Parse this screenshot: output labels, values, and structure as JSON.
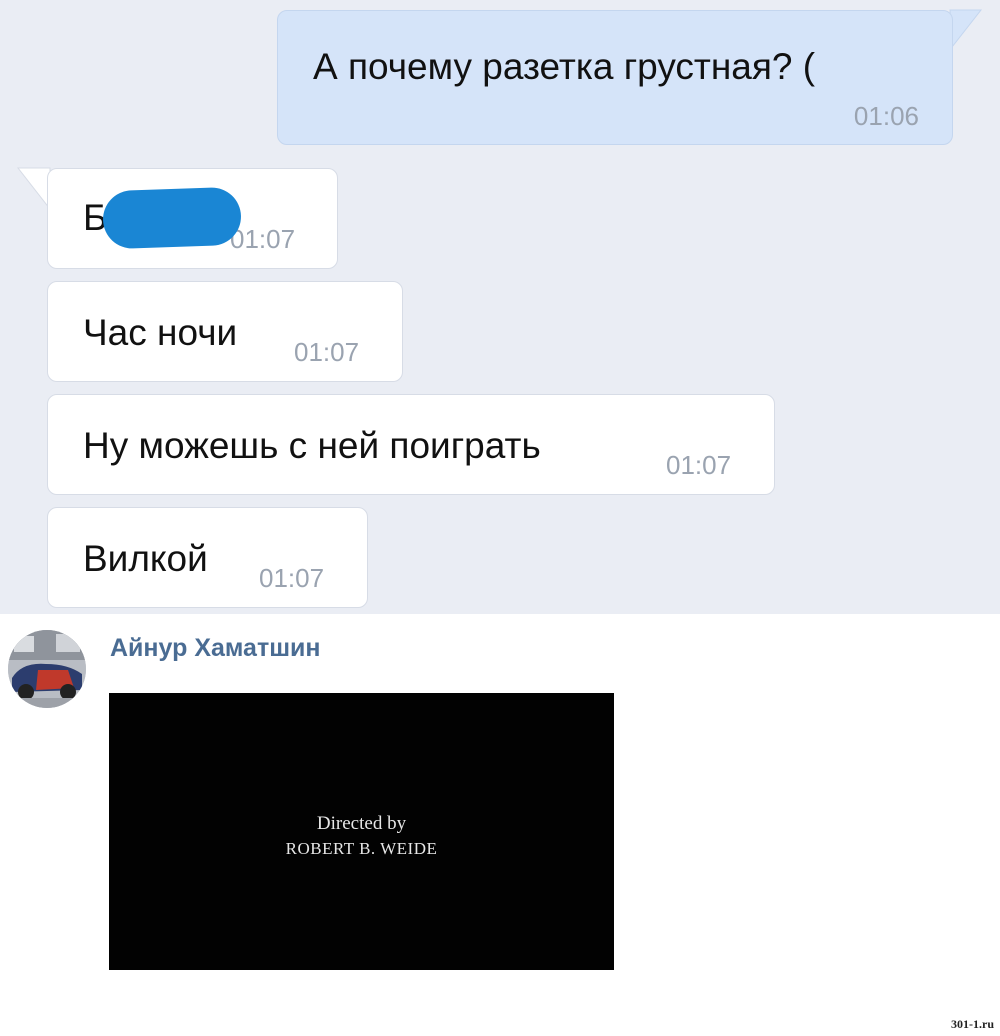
{
  "messages": [
    {
      "direction": "outgoing",
      "text": "А почему разетка грустная? (",
      "time": "01:06"
    },
    {
      "direction": "incoming",
      "text": "Б",
      "time": "01:07",
      "redacted": true
    },
    {
      "direction": "incoming",
      "text": "Час ночи",
      "time": "01:07"
    },
    {
      "direction": "incoming",
      "text": "Ну можешь с ней поиграть",
      "time": "01:07"
    },
    {
      "direction": "incoming",
      "text": "Вилкой",
      "time": "01:07"
    }
  ],
  "comment": {
    "author": "Айнур Хаматшин",
    "video": {
      "line1": "Directed by",
      "line2": "ROBERT B. WEIDE"
    }
  },
  "watermark": "301-1.ru",
  "colors": {
    "chat_background": "#eaedf4",
    "outgoing_bubble": "#d5e4f9",
    "incoming_bubble": "#ffffff",
    "timestamp": "#9aa3b0",
    "author_link": "#4a6c93",
    "redaction_blob": "#1a86d4",
    "video_background": "#020202"
  }
}
